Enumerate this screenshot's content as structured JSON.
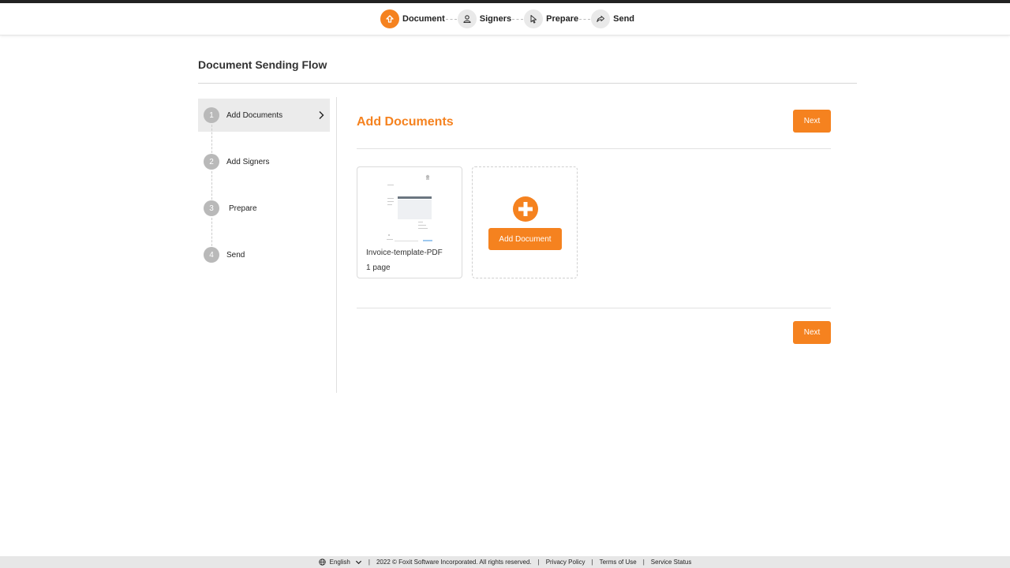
{
  "stepper": {
    "steps": [
      {
        "label": "Document",
        "icon": "upload-arrow-icon",
        "active": true
      },
      {
        "label": "Signers",
        "icon": "person-icon",
        "active": false
      },
      {
        "label": "Prepare",
        "icon": "cursor-pointer-icon",
        "active": false
      },
      {
        "label": "Send",
        "icon": "share-arrow-icon",
        "active": false
      }
    ]
  },
  "page": {
    "title": "Document Sending Flow"
  },
  "side_nav": {
    "items": [
      {
        "number": "1",
        "label": "Add Documents",
        "active": true
      },
      {
        "number": "2",
        "label": "Add Signers",
        "active": false
      },
      {
        "number": "3",
        "label": "Prepare",
        "active": false
      },
      {
        "number": "4",
        "label": "Send",
        "active": false
      }
    ]
  },
  "main": {
    "heading": "Add Documents",
    "next_label_top": "Next",
    "next_label_bottom": "Next",
    "document": {
      "name": "Invoice-template-PDF",
      "pages": "1 page"
    },
    "add_document_label": "Add Document"
  },
  "footer": {
    "language": "English",
    "copyright": "2022 © Foxit Software Incorporated. All rights reserved.",
    "privacy": "Privacy Policy",
    "terms": "Terms of Use",
    "status": "Service Status"
  },
  "colors": {
    "accent": "#f5821f",
    "nav_active_bg": "#ebebeb",
    "footer_bg": "#e7e7e7"
  }
}
